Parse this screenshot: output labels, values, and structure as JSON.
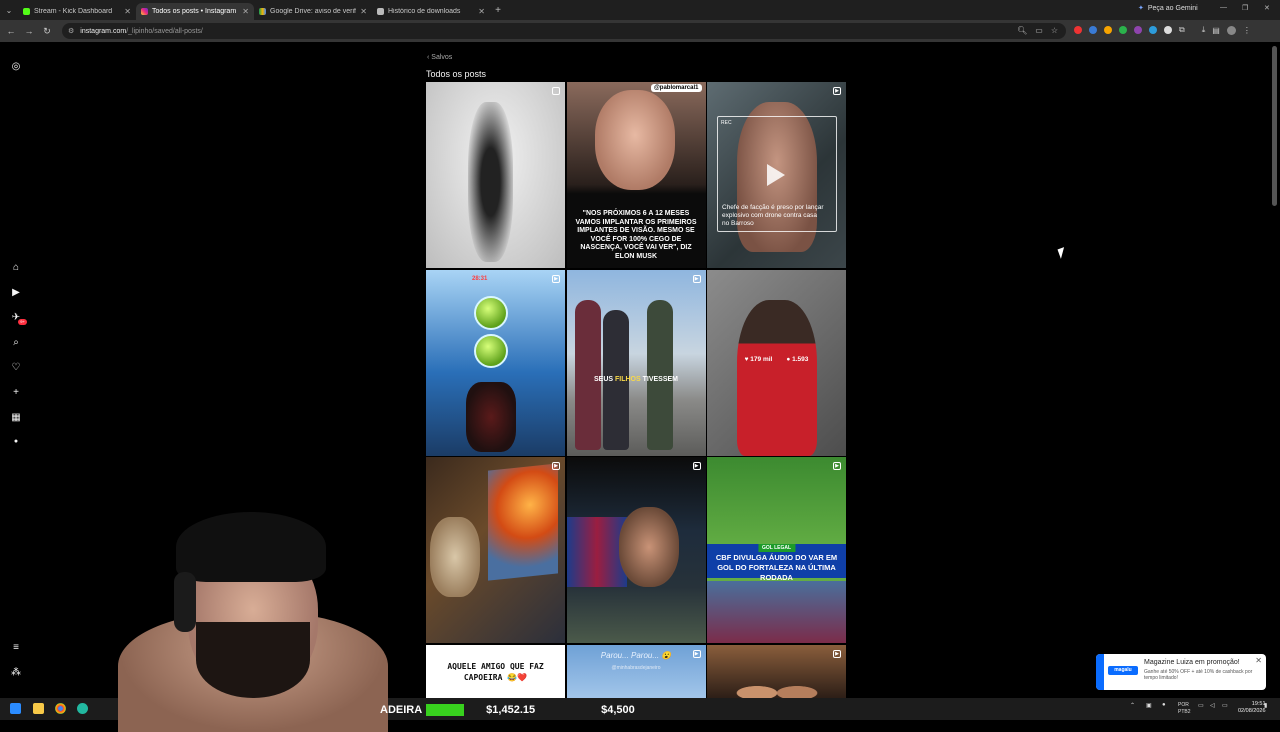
{
  "browser": {
    "tabs": [
      {
        "title": "Stream - Kick Dashboard",
        "color": "#53fc18",
        "active": false
      },
      {
        "title": "Todos os posts • Instagram",
        "color": "#e1306c",
        "active": true
      },
      {
        "title": "Google Drive: aviso de verificação",
        "color": "#f4b400",
        "active": false
      },
      {
        "title": "Histórico de downloads",
        "color": "#bbbbbb",
        "active": false
      }
    ],
    "gemini_label": "Peça ao Gemini",
    "url_host": "instagram.com",
    "url_path": "/_lipinho/saved/all-posts/"
  },
  "page": {
    "back_label": "Salvos",
    "title": "Todos os posts"
  },
  "posts": {
    "p2_handle": "@pablomarcal1",
    "p2_caption": "\"NOS PRÓXIMOS 6 A 12 MESES VAMOS IMPLANTAR OS PRIMEIROS IMPLANTES DE VISÃO. MESMO SE VOCÊ FOR 100% CEGO DE NASCENÇA, VOCÊ VAI VER\", DIZ ELON MUSK",
    "p3_rec": "REC",
    "p3_caption": "Chefe de facção é preso por lançar explosivo com drone contra casa no Barroso",
    "p4_hud": "28:31",
    "p5_caption_a": "SEUS ",
    "p5_caption_hl": "FILHOS",
    "p5_caption_b": " TIVESSEM",
    "p6_likes": "179 mil",
    "p6_comments": "1.593",
    "p9_tag": "GOL LEGAL",
    "p9_caption": "CBF DIVULGA ÁUDIO DO VAR EM GOL DO FORTALEZA NA ÚLTIMA RODADA",
    "p10_caption": "AQUELE AMIGO QUE FAZ CAPOEIRA 😂❤️",
    "p11_caption": "Parou... Parou... 😮",
    "p11_sub": "@minhabrasdejaneiro"
  },
  "stream": {
    "ticker_text": "ADEIRA",
    "value_1": "$1,452.15",
    "value_2": "$4,500"
  },
  "toast": {
    "brand": "magalu",
    "title": "Magazine Luiza em promoção!",
    "body": "Ganhe até 50% OFF + até 10% de cashback por tempo limitado!"
  },
  "taskbar": {
    "lang": "POR",
    "layout": "PTB2",
    "time": "19:51",
    "date": "02/08/2026"
  }
}
